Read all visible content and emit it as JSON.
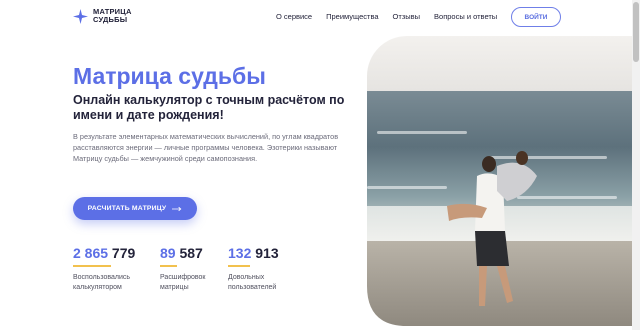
{
  "header": {
    "logo_line1": "МАТРИЦА",
    "logo_line2": "СУДЬБЫ",
    "nav": [
      "О сервисе",
      "Преимущества",
      "Отзывы",
      "Вопросы и ответы"
    ],
    "login": "ВОЙТИ"
  },
  "hero": {
    "title": "Матрица судьбы",
    "subtitle": "Онлайн калькулятор с точным расчётом по имени и дате рождения!",
    "description": "В результате элементарных математических вычислений, по углам квадратов расставляются энергии — личные программы человека. Эзотерики называют Матрицу судьбы — жемчужиной среди самопознания.",
    "cta": "РАСЧИТАТЬ МАТРИЦУ"
  },
  "stats": [
    {
      "highlight": "2 865",
      "rest": " 779",
      "label": "Воспользовались калькулятором"
    },
    {
      "highlight": "89",
      "rest": " 587",
      "label": "Расшифровок матрицы"
    },
    {
      "highlight": "132",
      "rest": " 913",
      "label": "Довольных пользователей"
    }
  ],
  "colors": {
    "accent": "#5c6fe6",
    "underline": "#f2c14e",
    "text": "#23233a"
  }
}
